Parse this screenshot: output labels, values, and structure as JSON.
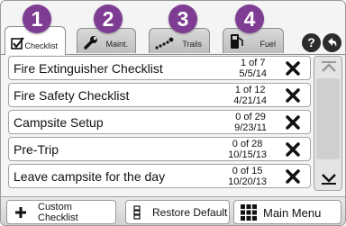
{
  "badges": [
    "1",
    "2",
    "3",
    "4"
  ],
  "tabs": [
    {
      "label": "Checklist",
      "icon": "checkbox-icon",
      "active": true
    },
    {
      "label": "Maint.",
      "icon": "wrench-icon",
      "active": false
    },
    {
      "label": "Trails",
      "icon": "trail-icon",
      "active": false
    },
    {
      "label": "Fuel",
      "icon": "fuel-pump-icon",
      "active": false
    }
  ],
  "header_buttons": {
    "help": "?",
    "back": "back-arrow-icon"
  },
  "checklists": [
    {
      "title": "Fire Extinguisher Checklist",
      "progress": "1 of 7",
      "date": "5/5/14"
    },
    {
      "title": "Fire Safety Checklist",
      "progress": "1 of 12",
      "date": "4/21/14"
    },
    {
      "title": "Campsite Setup",
      "progress": "0 of 29",
      "date": "9/23/11"
    },
    {
      "title": "Pre-Trip",
      "progress": "0 of 28",
      "date": "10/15/13"
    },
    {
      "title": "Leave campsite for the day",
      "progress": "0 of 15",
      "date": "10/20/13"
    }
  ],
  "bottom": {
    "custom_line1": "Custom",
    "custom_line2": "Checklist",
    "restore": "Restore Default",
    "main_menu": "Main Menu"
  },
  "colors": {
    "badge": "#7e3d93",
    "accent_dark": "#2b2b2b"
  }
}
